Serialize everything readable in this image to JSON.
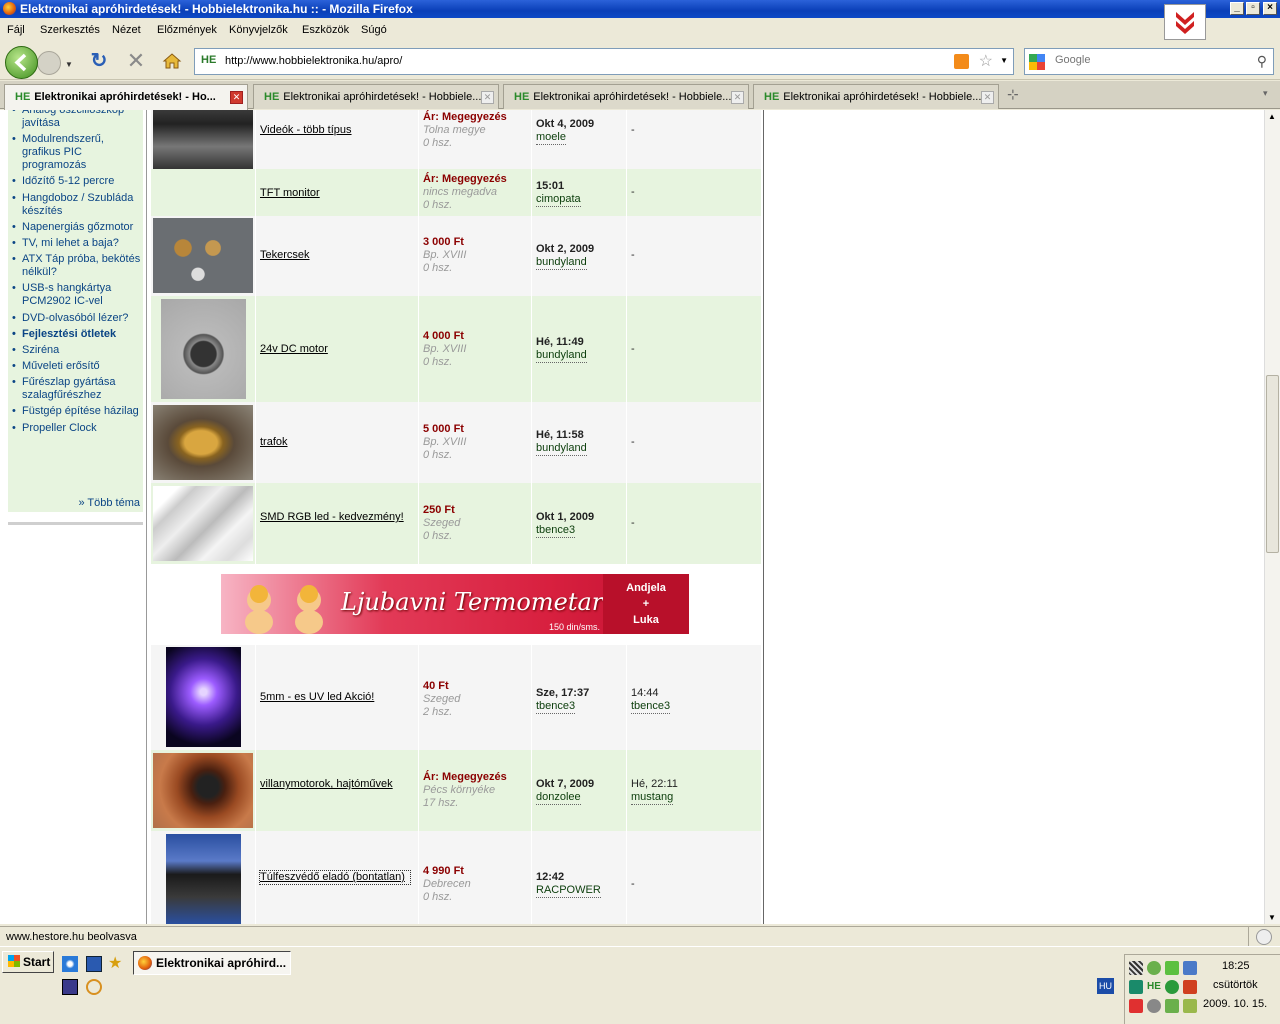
{
  "window": {
    "title": "Elektronikai apróhirdetések! - Hobbielektronika.hu :: - Mozilla Firefox"
  },
  "menu": [
    "Fájl",
    "Szerkesztés",
    "Nézet",
    "Előzmények",
    "Könyvjelzők",
    "Eszközök",
    "Súgó"
  ],
  "nav": {
    "url": "http://www.hobbielektronika.hu/apro/",
    "favicon": "HE",
    "search_placeholder": "Google"
  },
  "tabs": [
    {
      "label": "Elektronikai apróhirdetések! - Ho...",
      "favicon": "HE"
    },
    {
      "label": "Elektronikai apróhirdetések! - Hobbiele...",
      "favicon": "HE"
    },
    {
      "label": "Elektronikai apróhirdetések! - Hobbiele...",
      "favicon": "HE"
    },
    {
      "label": "Elektronikai apróhirdetések! - Hobbiele...",
      "favicon": "HE"
    }
  ],
  "sidebar": {
    "items": [
      {
        "label": "Analóg oszcilloszkóp javítása"
      },
      {
        "label": "Modulrendszerű, grafikus PIC programozás"
      },
      {
        "label": "Időzítő 5-12 percre"
      },
      {
        "label": "Hangdoboz / Szubláda készítés"
      },
      {
        "label": "Napenergiás gőzmotor"
      },
      {
        "label": "TV, mi lehet a baja?"
      },
      {
        "label": "ATX Táp próba, bekötés nélkül?"
      },
      {
        "label": "USB-s hangkártya PCM2902 IC-vel"
      },
      {
        "label": "DVD-olvasóból lézer?"
      },
      {
        "label": "Fejlesztési ötletek"
      },
      {
        "label": "Sziréna"
      },
      {
        "label": "Műveleti erősítő"
      },
      {
        "label": "Fűrészlap gyártása szalagfűrészhez"
      },
      {
        "label": "Füstgép építése házilag"
      },
      {
        "label": "Propeller Clock"
      }
    ],
    "more": "» Több téma"
  },
  "listings": [
    {
      "title": "Videók - több típus",
      "price": "Ár: Megegyezés",
      "location": "Tolna megye",
      "comments": "0 hsz.",
      "date": "Okt 4, 2009",
      "user": "moele",
      "last": "-",
      "last_user": ""
    },
    {
      "title": "TFT monitor",
      "price": "Ár: Megegyezés",
      "location": "nincs megadva",
      "comments": "0 hsz.",
      "date": "15:01",
      "user": "cimopata",
      "last": "-",
      "last_user": ""
    },
    {
      "title": "Tekercsek",
      "price": "3 000 Ft",
      "location": "Bp. XVIII",
      "comments": "0 hsz.",
      "date": "Okt 2, 2009",
      "user": "bundyland",
      "last": "-",
      "last_user": ""
    },
    {
      "title": "24v DC motor",
      "price": "4 000 Ft",
      "location": "Bp. XVIII",
      "comments": "0 hsz.",
      "date": "Hé, 11:49",
      "user": "bundyland",
      "last": "-",
      "last_user": ""
    },
    {
      "title": "trafok",
      "price": "5 000 Ft",
      "location": "Bp. XVIII",
      "comments": "0 hsz.",
      "date": "Hé, 11:58",
      "user": "bundyland",
      "last": "-",
      "last_user": ""
    },
    {
      "title": "SMD RGB led - kedvezmény!",
      "price": "250 Ft",
      "location": "Szeged",
      "comments": "0 hsz.",
      "date": "Okt 1, 2009",
      "user": "tbence3",
      "last": "-",
      "last_user": ""
    },
    {
      "title": "5mm - es UV led Akció!",
      "price": "40 Ft",
      "location": "Szeged",
      "comments": "2 hsz.",
      "date": "Sze, 17:37",
      "user": "tbence3",
      "last": "14:44",
      "last_user": "tbence3"
    },
    {
      "title": "villanymotorok, hajtóművek",
      "price": "Ár: Megegyezés",
      "location": "Pécs környéke",
      "comments": "17 hsz.",
      "date": "Okt 7, 2009",
      "user": "donzolee",
      "last": "Hé, 22:11",
      "last_user": "mustang"
    },
    {
      "title": "Túlfeszvédő eladó (bontatlan)",
      "price": "4 990 Ft",
      "location": "Debrecen",
      "comments": "0 hsz.",
      "date": "12:42",
      "user": "RACPOWER",
      "last": "-",
      "last_user": ""
    }
  ],
  "banner": {
    "text": "Ljubavni Termometar",
    "side": [
      "Andjela",
      "+",
      "Luka"
    ],
    "price": "150 din/sms."
  },
  "status": {
    "text": "www.hestore.hu beolvasva"
  },
  "taskbar": {
    "start": "Start",
    "task": "Elektronikai apróhird...",
    "lang": "HU",
    "time": "18:25",
    "day": "csütörtök",
    "date": "2009. 10. 15."
  }
}
